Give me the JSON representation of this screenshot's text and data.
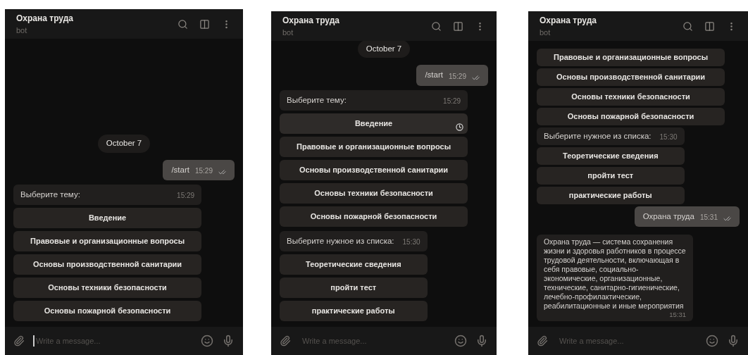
{
  "panels": [
    {
      "header": {
        "title": "Охрана труда",
        "subtitle": "bot"
      },
      "messages": [
        {
          "kind": "date",
          "text": "October 7"
        },
        {
          "kind": "outgoing",
          "text": "/start",
          "time": "15:29",
          "read": true
        },
        {
          "kind": "incoming",
          "text": "Выберите тему:",
          "time": "15:29",
          "buttons": [
            {
              "label": "Введение",
              "pending": false
            },
            {
              "label": "Правовые и организационные вопросы",
              "pending": false
            },
            {
              "label": "Основы производственной санитарии",
              "pending": false
            },
            {
              "label": "Основы техники безопасности",
              "pending": false
            },
            {
              "label": "Основы пожарной безопасности",
              "pending": false
            }
          ]
        }
      ],
      "composer": {
        "placeholder": "Write a message...",
        "focused": true
      }
    },
    {
      "header": {
        "title": "Охрана труда",
        "subtitle": "bot"
      },
      "messages": [
        {
          "kind": "date",
          "text": "October 7"
        },
        {
          "kind": "outgoing",
          "text": "/start",
          "time": "15:29",
          "read": true
        },
        {
          "kind": "incoming",
          "text": "Выберите тему:",
          "time": "15:29",
          "buttons": [
            {
              "label": "Введение",
              "pending": true
            },
            {
              "label": "Правовые и организационные вопросы",
              "pending": false
            },
            {
              "label": "Основы производственной санитарии",
              "pending": false
            },
            {
              "label": "Основы техники безопасности",
              "pending": false
            },
            {
              "label": "Основы пожарной безопасности",
              "pending": false
            }
          ]
        },
        {
          "kind": "incoming",
          "text": "Выберите нужное из списка:",
          "time": "15:30",
          "buttons": [
            {
              "label": "Теоретические сведения",
              "pending": false
            },
            {
              "label": "пройти тест",
              "pending": false
            },
            {
              "label": "практические работы",
              "pending": false
            }
          ]
        }
      ],
      "composer": {
        "placeholder": "Write a message...",
        "focused": false
      }
    },
    {
      "header": {
        "title": "Охрана труда",
        "subtitle": "bot"
      },
      "messages": [
        {
          "kind": "keyboard",
          "buttons": [
            {
              "label": "Правовые и организационные вопросы",
              "pending": false
            },
            {
              "label": "Основы производственной санитарии",
              "pending": false
            },
            {
              "label": "Основы техники безопасности",
              "pending": false
            },
            {
              "label": "Основы пожарной безопасности",
              "pending": false
            }
          ]
        },
        {
          "kind": "incoming",
          "text": "Выберите нужное из списка:",
          "time": "15:30",
          "buttons": [
            {
              "label": "Теоретические сведения",
              "pending": false
            },
            {
              "label": "пройти тест",
              "pending": false
            },
            {
              "label": "практические работы",
              "pending": false
            }
          ]
        },
        {
          "kind": "outgoing",
          "text": "Охрана труда",
          "time": "15:31",
          "read": true
        },
        {
          "kind": "article",
          "text": "Охрана труда — система сохранения жизни и здоровья работников в процессе трудовой деятельности, включающая в себя правовые, социально-экономические, организационные, технические, санитарно-гигиенические, лечебно-профилактические, реабилитационные и иные мероприятия",
          "time": "15:31"
        }
      ],
      "composer": {
        "placeholder": "Write a message...",
        "focused": false
      }
    }
  ]
}
